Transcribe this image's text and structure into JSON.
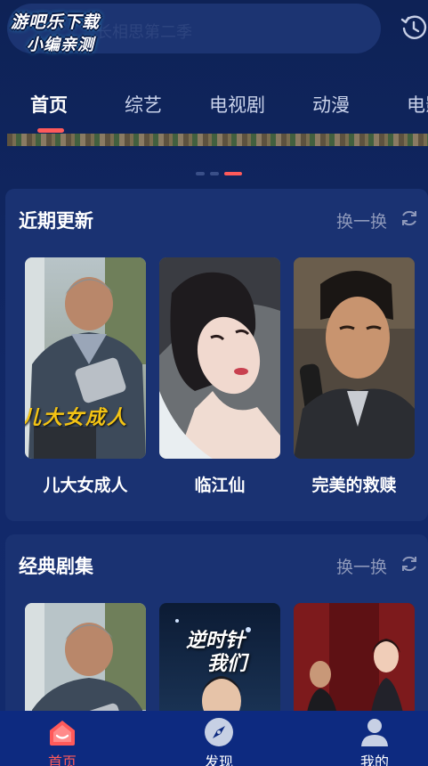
{
  "header": {
    "search_placeholder": "长相思第二季",
    "logo_line1": "游吧乐下载",
    "logo_line2": "小编亲测",
    "history_icon": "history-icon"
  },
  "tabs": [
    {
      "label": "首页",
      "active": true
    },
    {
      "label": "综艺",
      "active": false
    },
    {
      "label": "电视剧",
      "active": false
    },
    {
      "label": "动漫",
      "active": false
    },
    {
      "label": "电影",
      "active": false
    }
  ],
  "carousel": {
    "page_count": 3,
    "active_index": 2
  },
  "sections": [
    {
      "title": "近期更新",
      "refresh_label": "换一换",
      "items": [
        {
          "title": "儿大女成人",
          "overlay": "儿大女成人"
        },
        {
          "title": "临江仙"
        },
        {
          "title": "完美的救赎"
        }
      ]
    },
    {
      "title": "经典剧集",
      "refresh_label": "换一换",
      "items": [
        {
          "title": ""
        },
        {
          "title": "",
          "overlay_line1": "逆时针",
          "overlay_line2": "我们"
        },
        {
          "title": ""
        }
      ]
    }
  ],
  "bottom_nav": [
    {
      "label": "首页",
      "icon": "home-icon",
      "active": true
    },
    {
      "label": "发现",
      "icon": "compass-icon",
      "active": false
    },
    {
      "label": "我的",
      "icon": "user-icon",
      "active": false
    }
  ],
  "colors": {
    "accent": "#ff5a5a",
    "background": "#0f2457",
    "card": "#1a3272",
    "nav": "#0d2a80"
  }
}
